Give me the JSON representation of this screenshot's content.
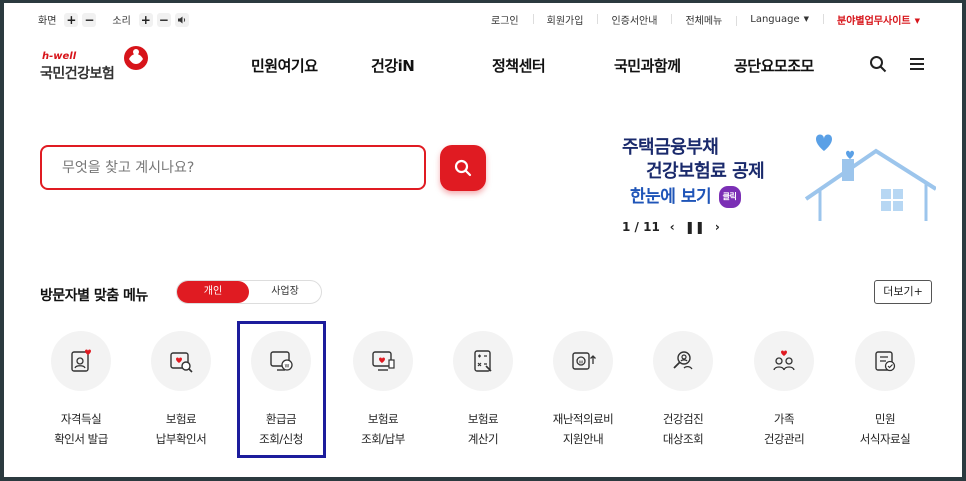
{
  "utility": {
    "screen_label": "화면",
    "sound_label": "소리",
    "plus": "+",
    "minus": "−",
    "links": [
      "로그인",
      "회원가입",
      "인증서안내",
      "전체메뉴"
    ],
    "language": "Language",
    "field_sites": "분야별업무사이트"
  },
  "logo": {
    "tagline": "h-well",
    "name": "국민건강보험"
  },
  "gnb": {
    "items": [
      "민원여기요",
      "건강iN",
      "정책센터",
      "국민과함께",
      "공단요모조모"
    ]
  },
  "search": {
    "placeholder": "무엇을 찾고 계시나요?"
  },
  "banner": {
    "line1": "주택금융부채",
    "line2": "건강보험료 공제",
    "line3": "한눈에 보기",
    "click": "클릭",
    "page": "1 / 11"
  },
  "section": {
    "title": "방문자별 맞춤 메뉴",
    "tabs": [
      "개인",
      "사업장"
    ],
    "more": "더보기+"
  },
  "menu": [
    {
      "label": "자격득실\n확인서 발급",
      "icon": "certificate-heart-icon"
    },
    {
      "label": "보험료\n납부확인서",
      "icon": "payment-search-icon"
    },
    {
      "label": "환급금\n조회/신청",
      "icon": "refund-monitor-icon"
    },
    {
      "label": "보험료\n조회/납부",
      "icon": "premium-screen-icon"
    },
    {
      "label": "보험료\n계산기",
      "icon": "calculator-icon"
    },
    {
      "label": "재난적의료비\n지원안내",
      "icon": "medical-support-icon"
    },
    {
      "label": "건강검진\n대상조회",
      "icon": "checkup-search-icon"
    },
    {
      "label": "가족\n건강관리",
      "icon": "family-heart-icon"
    },
    {
      "label": "민원\n서식자료실",
      "icon": "form-document-icon"
    }
  ],
  "colors": {
    "accent": "#e01b22",
    "navy": "#1a2a6c",
    "highlight": "#1c1c9c"
  }
}
